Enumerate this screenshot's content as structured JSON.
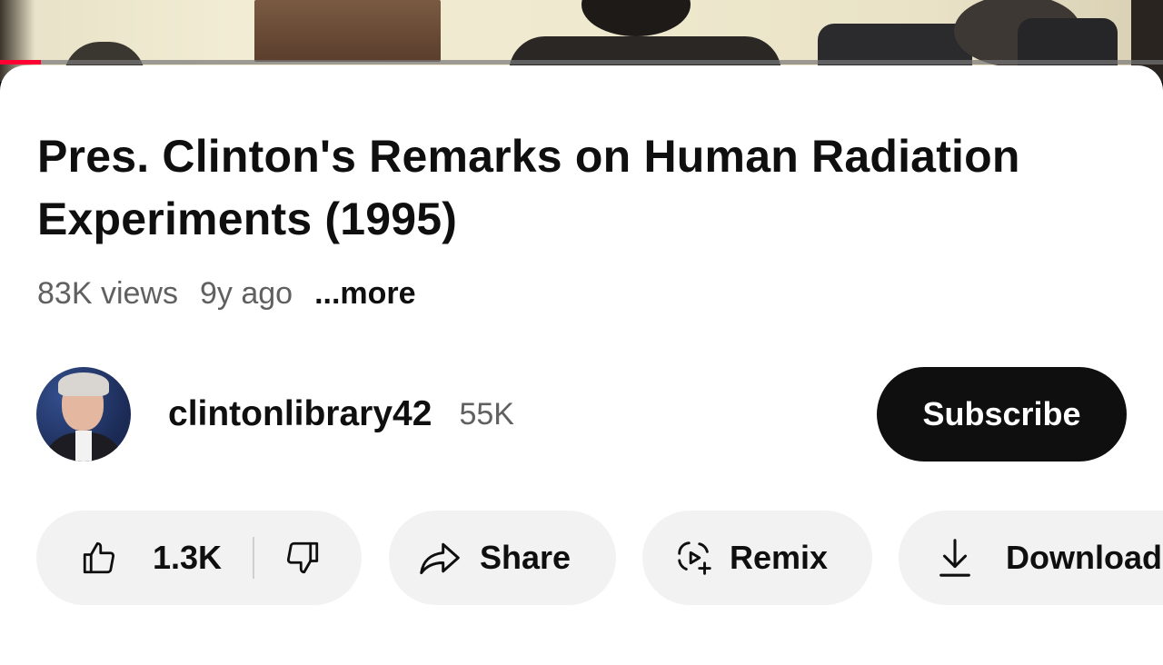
{
  "video": {
    "progress_fraction": 0.035,
    "progress_color": "#ff0033"
  },
  "title": "Pres. Clinton's Remarks on Human Radiation Experiments (1995)",
  "meta": {
    "views": "83K views",
    "age": "9y ago",
    "more": "...more"
  },
  "channel": {
    "name": "clintonlibrary42",
    "subscribers": "55K",
    "subscribe_label": "Subscribe"
  },
  "actions": {
    "like_count": "1.3K",
    "share_label": "Share",
    "remix_label": "Remix",
    "download_label": "Download"
  },
  "icons": {
    "like": "thumbs-up-icon",
    "dislike": "thumbs-down-icon",
    "share": "share-arrow-icon",
    "remix": "remix-icon",
    "download": "download-icon"
  }
}
